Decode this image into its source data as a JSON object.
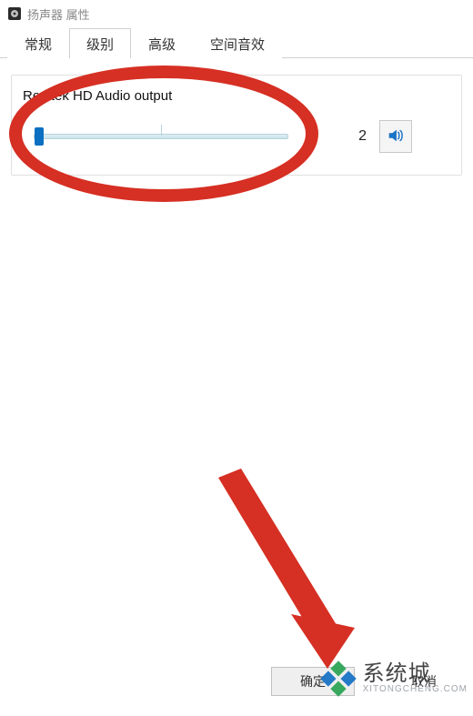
{
  "window": {
    "title": "扬声器 属性"
  },
  "tabs": [
    {
      "label": "常规",
      "active": false
    },
    {
      "label": "级别",
      "active": true
    },
    {
      "label": "高级",
      "active": false
    },
    {
      "label": "空间音效",
      "active": false
    }
  ],
  "device": {
    "name": "Realtek HD Audio output",
    "volume_value": "2",
    "slider_percent": 2
  },
  "buttons": {
    "ok": "确定",
    "cancel": "取消"
  },
  "watermark": {
    "brand": "系统城",
    "sub": "XITONGCHENG.COM"
  },
  "annotation": {
    "ellipse_color": "#d62f23",
    "arrow_color": "#d62f23"
  }
}
